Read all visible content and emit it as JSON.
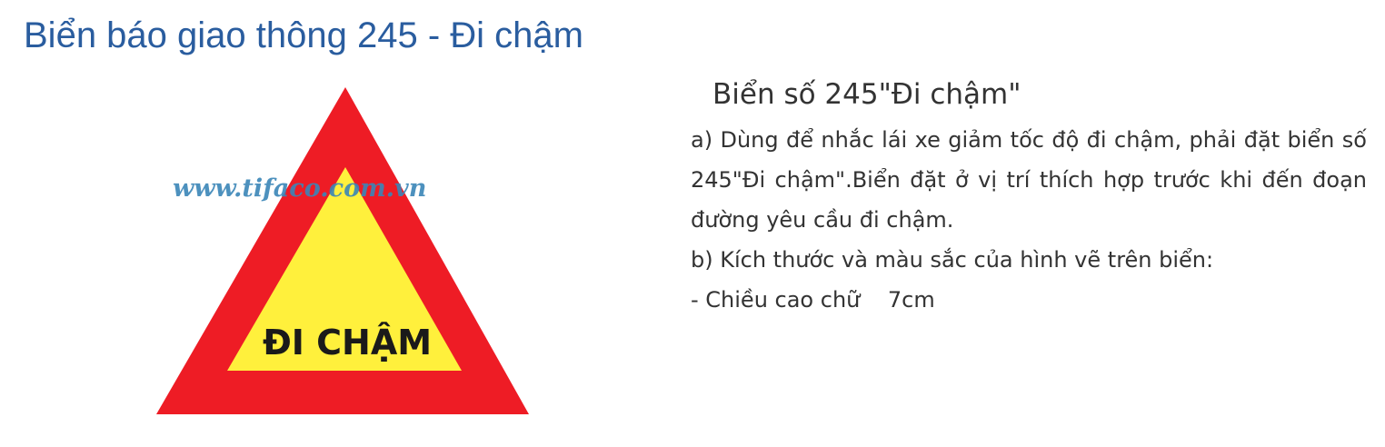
{
  "page": {
    "title": "Biển báo giao thông 245 - Đi chậm"
  },
  "figure": {
    "watermark": "www.tifaco.com.vn",
    "sign_text": "ĐI CHẬM",
    "colors": {
      "border": "#ee1c25",
      "fill": "#fff03c",
      "text": "#1a1a1a",
      "watermark": "#3a86b8"
    }
  },
  "article": {
    "heading": "Biển số 245\"Đi chậm\"",
    "para_a": "a) Dùng để nhắc lái xe giảm tốc độ đi chậm, phải đặt biển  số 245\"Đi chậm\".Biển đặt ở vị trí thích hợp trước khi đến đoạn đường yêu cầu đi chậm.",
    "para_b": "b) Kích thước và màu sắc của hình vẽ trên biển:",
    "spec_line": "- Chiều cao chữ    7cm"
  },
  "colors": {
    "title": "#2a5d9f",
    "body_text": "#333333"
  }
}
